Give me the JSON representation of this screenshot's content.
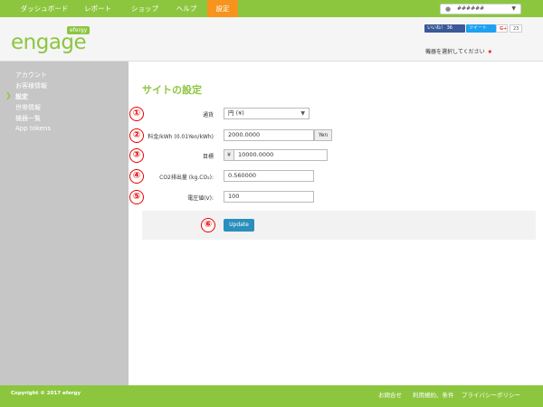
{
  "nav": {
    "items": [
      {
        "label": "ダッシュボード"
      },
      {
        "label": "レポート"
      },
      {
        "label": "ショップ"
      },
      {
        "label": "ヘルプ"
      },
      {
        "label": "設定"
      }
    ],
    "user_name": "######"
  },
  "header": {
    "logo_text": "engage",
    "logo_badge": "efergy",
    "fb_label": "いいね！ 36",
    "tw_label": "ツイート",
    "gp_label": "G+",
    "gp_count": "23",
    "device_prompt": "機器を選択してください",
    "device_star": "★"
  },
  "sidebar": {
    "items": [
      {
        "label": "アカウント"
      },
      {
        "label": "お客様情報"
      },
      {
        "label": "設定"
      },
      {
        "label": "世帯情報"
      },
      {
        "label": "機器一覧"
      },
      {
        "label": "App tokens"
      }
    ]
  },
  "main": {
    "title": "サイトの設定",
    "currency_label": "通貨",
    "currency_value": "円 (¥)",
    "rate_label": "料金/kWh (0.01Yen/kWh)",
    "rate_value": "2000.0000",
    "rate_unit": "Yen",
    "target_label": "目標",
    "target_prefix": "¥",
    "target_value": "10000.0000",
    "co2_label": "CO2排出量 (kg.CO₂):",
    "co2_value": "0.560000",
    "voltage_label": "電圧値(V):",
    "voltage_value": "100",
    "update_label": "Update",
    "markers": [
      "①",
      "②",
      "③",
      "④",
      "⑤",
      "⑥"
    ]
  },
  "footer": {
    "copyright": "Copyright © 2017 efergy",
    "links": [
      {
        "label": "お問合せ"
      },
      {
        "label": "利用規約、条件"
      },
      {
        "label": "プライバシーポリシー"
      }
    ]
  },
  "colors": {
    "brand_green": "#8cc63f",
    "active_orange": "#f7941d",
    "marker_red": "#e00000",
    "button_blue": "#2a8fbd"
  }
}
